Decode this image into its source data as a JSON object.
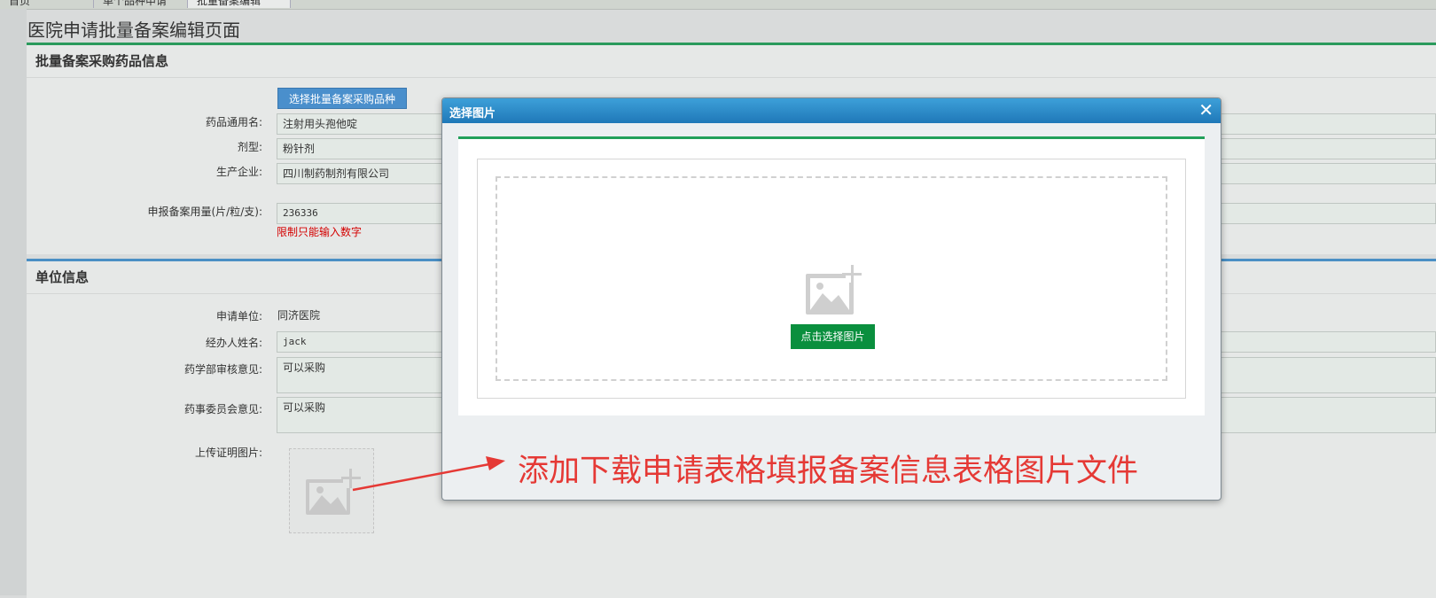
{
  "tabs": [
    {
      "label": "首页",
      "active": false
    },
    {
      "label": "单个品种申请",
      "active": false
    },
    {
      "label": "批量备案编辑",
      "active": true
    }
  ],
  "page_title": "医院申请批量备案编辑页面",
  "drug_section": {
    "title": "批量备案采购药品信息",
    "select_button": "选择批量备案采购品种",
    "generic_name_label": "药品通用名:",
    "generic_name_value": "注射用头孢他啶",
    "dosage_form_label": "剂型:",
    "dosage_form_value": "粉针剂",
    "manufacturer_label": "生产企业:",
    "manufacturer_value": "四川制药制剂有限公司",
    "quantity_label": "申报备案用量(片/粒/支):",
    "quantity_value": "236336",
    "quantity_hint": "限制只能输入数字"
  },
  "unit_section": {
    "title": "单位信息",
    "applicant_label": "申请单位:",
    "applicant_value": "同济医院",
    "handler_label": "经办人姓名:",
    "handler_value": "jack",
    "pharmacy_label": "药学部审核意见:",
    "pharmacy_value": "可以采购",
    "committee_label": "药事委员会意见:",
    "committee_value": "可以采购",
    "upload_label": "上传证明图片:"
  },
  "modal": {
    "title": "选择图片",
    "close_glyph": "✕",
    "choose_button": "点击选择图片"
  },
  "annotation": "添加下载申请表格填报备案信息表格图片文件",
  "colors": {
    "accent_green": "#0a8f3e",
    "accent_blue": "#1f78b8",
    "annotation_red": "#e53935"
  }
}
